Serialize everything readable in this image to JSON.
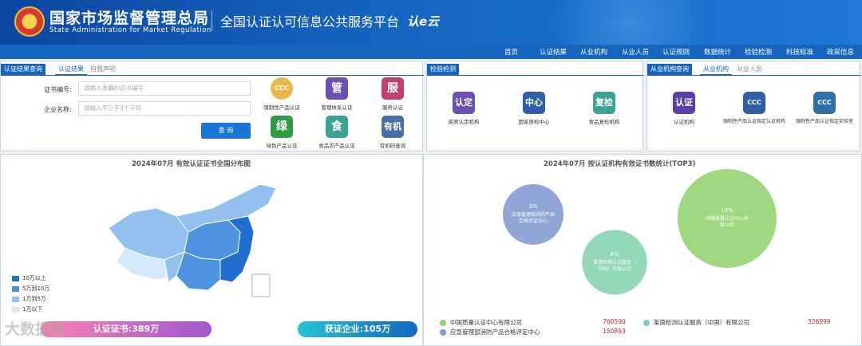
{
  "header": {
    "org_cn": "国家市场监督管理总局",
    "org_en": "State Administration  for  Market Regulation",
    "platform": "全国认证认可信息公共服务平台",
    "logo_text": "认e云",
    "emblem_glyph": "☆"
  },
  "nav": [
    "首页",
    "认证结果",
    "从业机构",
    "从业人员",
    "认证规则",
    "数据统计",
    "检验检测",
    "科技标准",
    "政采信息"
  ],
  "cert_panel": {
    "tabs": [
      "认证结果查询",
      "认证结果",
      "自我声明"
    ],
    "fields": [
      {
        "label": "证书编号:",
        "placeholder": "请输入准确的证书编号"
      },
      {
        "label": "企业名称:",
        "placeholder": "请输入不少于3个字符"
      }
    ],
    "query_button": "查 询",
    "icons": [
      {
        "glyph": "CCC",
        "label": "强制性产品认证",
        "color": "#e8b84a",
        "icon": "ccc-icon"
      },
      {
        "glyph": "管",
        "label": "管理体系认证",
        "color": "#6b4fb5",
        "icon": "management-icon"
      },
      {
        "glyph": "服",
        "label": "服务认证",
        "color": "#c0416c",
        "icon": "service-icon"
      },
      {
        "glyph": "绿",
        "label": "绿色产品认证",
        "color": "#2e9b43",
        "icon": "green-icon"
      },
      {
        "glyph": "食",
        "label": "食品农产品认证",
        "color": "#3aa395",
        "icon": "food-icon"
      },
      {
        "glyph": "有机",
        "label": "有机码查询",
        "color": "#4a6fa8",
        "icon": "organic-icon"
      }
    ]
  },
  "test_panel": {
    "tab": "检验检测",
    "icons": [
      {
        "glyph": "认定",
        "label": "资质认定机构",
        "color": "#6b4fb5",
        "icon": "qualification-icon"
      },
      {
        "glyph": "中心",
        "label": "国家质检中心",
        "color": "#2f5fa8",
        "icon": "center-icon"
      },
      {
        "glyph": "复检",
        "label": "食品复检机构",
        "color": "#3aa395",
        "icon": "recheck-icon"
      }
    ]
  },
  "org_panel": {
    "tabs": [
      "从业机构查询",
      "从业机构",
      "从业人员"
    ],
    "icons": [
      {
        "glyph": "认证",
        "label": "认证机构",
        "color": "#5a3fa8",
        "icon": "cert-org-icon"
      },
      {
        "glyph": "CCC",
        "label": "强制性产品认证指定认证机构",
        "color": "#2f5fa8",
        "icon": "ccc-designated-icon"
      },
      {
        "glyph": "CCC",
        "label": "强制性产品认证指定实验室",
        "color": "#2f6fa8",
        "icon": "ccc-lab-icon"
      }
    ]
  },
  "map_panel": {
    "title": "2024年07月  有效认证证书全国分布图",
    "legend": [
      {
        "label": "10万以上",
        "color": "#1e6fd0"
      },
      {
        "label": "5万到10万",
        "color": "#4d93e0"
      },
      {
        "label": "1万到5万",
        "color": "#92c1ef"
      },
      {
        "label": "1万以下",
        "color": "#d4e9fa"
      }
    ],
    "cert_total": "认证证书:389万",
    "enterprise_total": "获证企业:105万"
  },
  "bubble_panel": {
    "title": "2024年07月  按认证机构有效证书数统计(TOP3)"
  },
  "chart_data": {
    "type": "bubble",
    "title": "2024年07月  按认证机构有效证书数统计(TOP3)",
    "series": [
      {
        "name": "中国质量认证中心有限公司",
        "short": "中国质量认证中心有限公司",
        "percent": "19%",
        "value": 760590,
        "color": "#8fd16b"
      },
      {
        "name": "应急管理部消防产品合格评定中心",
        "short": "应急管理部消防产品合格评定中心",
        "percent": "3%",
        "value": 150893,
        "color": "#7e97cf"
      },
      {
        "name": "莱茵检测认证服务（中国）有限公司",
        "short": "莱茵检测认证服务（中国）有限公司",
        "percent": "8%",
        "value": 326999,
        "color": "#7fd0ac"
      }
    ]
  },
  "watermark": "大数据猿"
}
